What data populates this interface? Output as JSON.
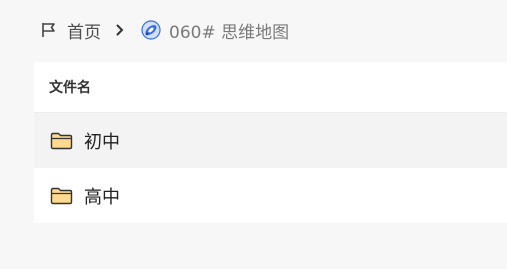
{
  "breadcrumb": {
    "home_label": "首页",
    "home_icon": "flag-icon",
    "separator_icon": "chevron-right-icon",
    "current_label": "060# 思维地图",
    "current_icon": "mindmap-icon"
  },
  "file_table": {
    "column_header": "文件名",
    "rows": [
      {
        "name": "初中",
        "icon": "folder-icon"
      },
      {
        "name": "高中",
        "icon": "folder-icon"
      }
    ]
  },
  "colors": {
    "background": "#f7f7f7",
    "panel": "#ffffff",
    "selected_row": "#f3f3f3",
    "folder_fill": "#ffd98e",
    "folder_stroke": "#333333",
    "mindmap_blue": "#3a6fd8"
  }
}
